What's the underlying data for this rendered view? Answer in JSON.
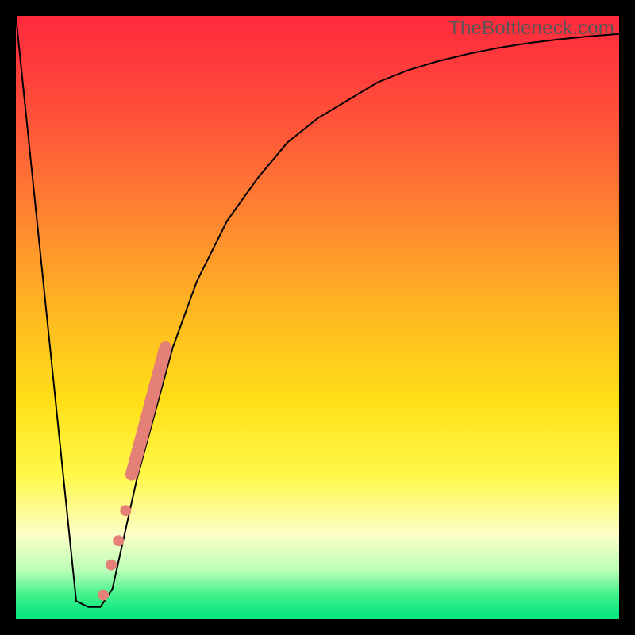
{
  "watermark": "TheBottleneck.com",
  "colors": {
    "curve_stroke": "#000000",
    "marker_fill": "#e58076",
    "marker_stroke": "#e58076"
  },
  "chart_data": {
    "type": "line",
    "title": "",
    "xlabel": "",
    "ylabel": "",
    "xlim": [
      0,
      100
    ],
    "ylim": [
      0,
      100
    ],
    "series": [
      {
        "name": "bottleneck-curve",
        "x": [
          0,
          10,
          12,
          14,
          16,
          18,
          20,
          23,
          26,
          30,
          35,
          40,
          45,
          50,
          55,
          60,
          65,
          70,
          75,
          80,
          85,
          90,
          95,
          100
        ],
        "values": [
          100,
          3,
          2,
          2,
          5,
          14,
          23,
          34,
          45,
          56,
          66,
          73,
          79,
          83,
          86,
          89,
          91,
          92.5,
          93.7,
          94.7,
          95.5,
          96.1,
          96.6,
          97
        ]
      }
    ],
    "markers": [
      {
        "x": 14.5,
        "y": 4
      },
      {
        "x": 15.8,
        "y": 9
      },
      {
        "x": 17.0,
        "y": 13
      },
      {
        "x": 18.2,
        "y": 18
      },
      {
        "x": 19.2,
        "y": 24
      },
      {
        "x": 20.0,
        "y": 27
      },
      {
        "x": 20.8,
        "y": 30
      },
      {
        "x": 21.6,
        "y": 33
      },
      {
        "x": 22.4,
        "y": 36
      },
      {
        "x": 23.2,
        "y": 39
      },
      {
        "x": 24.0,
        "y": 42
      },
      {
        "x": 24.8,
        "y": 45
      }
    ]
  }
}
